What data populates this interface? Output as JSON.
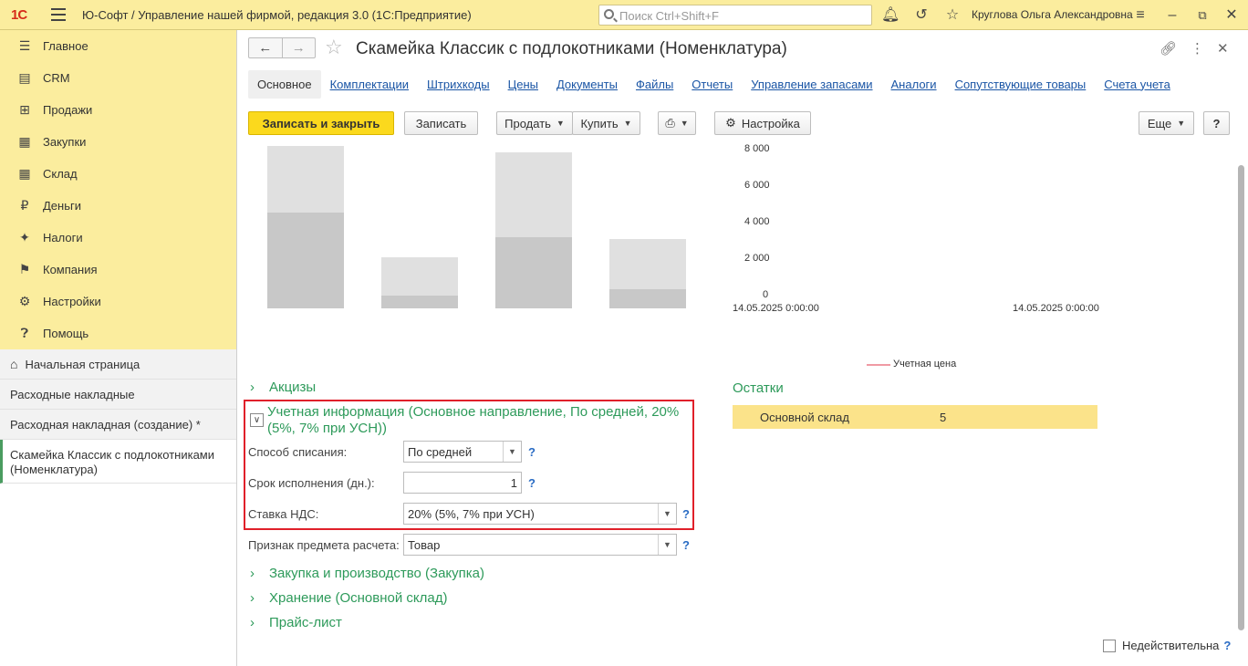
{
  "app": {
    "logo": "1С",
    "title": "Ю-Софт / Управление нашей фирмой, редакция 3.0  (1С:Предприятие)",
    "search_placeholder": "Поиск Ctrl+Shift+F",
    "user": "Круглова Ольга Александровна"
  },
  "sidebar": {
    "sections": [
      {
        "label": "Главное",
        "icon": "menu-icon"
      },
      {
        "label": "CRM",
        "icon": "crm-icon"
      },
      {
        "label": "Продажи",
        "icon": "basket-icon"
      },
      {
        "label": "Закупки",
        "icon": "purchases-icon"
      },
      {
        "label": "Склад",
        "icon": "warehouse-icon"
      },
      {
        "label": "Деньги",
        "icon": "ruble-icon"
      },
      {
        "label": "Налоги",
        "icon": "eagle-icon"
      },
      {
        "label": "Компания",
        "icon": "flag-icon"
      },
      {
        "label": "Настройки",
        "icon": "gear-icon"
      },
      {
        "label": "Помощь",
        "icon": "help-icon"
      }
    ],
    "open_windows": [
      {
        "label": "Начальная страница"
      },
      {
        "label": "Расходные накладные"
      },
      {
        "label": "Расходная накладная (создание) *"
      },
      {
        "label": "Скамейка Классик с подлокотниками (Номенклатура)"
      }
    ]
  },
  "document": {
    "title": "Скамейка Классик с подлокотниками (Номенклатура)",
    "tabs": [
      "Основное",
      "Комплектации",
      "Штрихкоды",
      "Цены",
      "Документы",
      "Файлы",
      "Отчеты",
      "Управление запасами",
      "Аналоги",
      "Сопутствующие товары",
      "Счета учета"
    ]
  },
  "toolbar": {
    "save_close": "Записать и закрыть",
    "save": "Записать",
    "sell": "Продать",
    "buy": "Купить",
    "settings": "Настройка",
    "more": "Еще",
    "help": "?"
  },
  "chart_data": {
    "type": "line",
    "y_ticks": [
      "8 000",
      "6 000",
      "4 000",
      "2 000",
      "0"
    ],
    "x_ticks": [
      "14.05.2025 0:00:00",
      "14.05.2025 0:00:00"
    ],
    "series": [
      {
        "name": "Учетная цена",
        "values": []
      }
    ],
    "ylim": [
      0,
      8000
    ],
    "legend": "bottom",
    "colors": {
      "series": "#f09aa4"
    }
  },
  "bars_chart": {
    "type": "bar",
    "values_total": [
      0.92,
      0.29,
      0.88,
      0.39
    ],
    "values_lower": [
      0.54,
      0.07,
      0.4,
      0.11
    ]
  },
  "groups": {
    "excise": "Акцизы",
    "accounting": "Учетная информация (Основное направление, По средней, 20% (5%, 7% при УСН))",
    "purchase": "Закупка и производство (Закупка)",
    "storage": "Хранение (Основной склад)",
    "pricelist": "Прайс-лист"
  },
  "fields": {
    "writeoff_label": "Способ списания:",
    "writeoff_value": "По средней",
    "term_label": "Срок исполнения (дн.):",
    "term_value": "1",
    "vat_label": "Ставка НДС:",
    "vat_value": "20% (5%, 7% при УСН)",
    "subject_label": "Признак предмета расчета:",
    "subject_value": "Товар",
    "help": "?"
  },
  "stock": {
    "title": "Остатки",
    "warehouse": "Основной склад",
    "qty": "5"
  },
  "footer": {
    "invalid_label": "Недействительна",
    "help": "?"
  },
  "colors": {
    "accent_yellow": "#fbed9e",
    "primary_button": "#fbd91d",
    "group_green": "#2d9a5a",
    "highlight_red": "#e0202a",
    "link_blue": "#1a55a5"
  }
}
